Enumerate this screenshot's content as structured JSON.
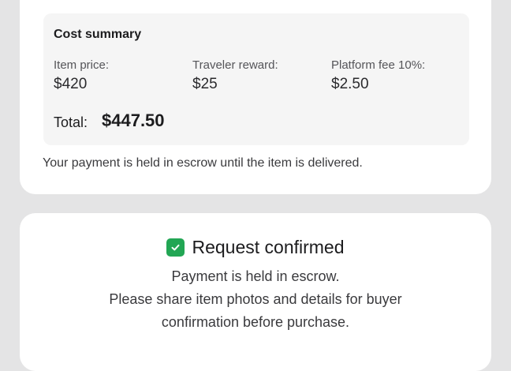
{
  "cost_summary": {
    "title": "Cost summary",
    "item_price_label": "Item price:",
    "item_price_value": "$420",
    "traveler_reward_label": "Traveler reward:",
    "traveler_reward_value": "$25",
    "platform_fee_label": "Platform fee 10%:",
    "platform_fee_value": "$2.50",
    "total_label": "Total:",
    "total_value": "$447.50"
  },
  "escrow_note": "Your payment is held in escrow until the item is delivered.",
  "confirmation": {
    "icon": "check-icon",
    "icon_color": "#22a654",
    "title": "Request confirmed",
    "line1": "Payment is held in escrow.",
    "line2": "Please share item photos and details for buyer",
    "line3": "confirmation before purchase."
  }
}
